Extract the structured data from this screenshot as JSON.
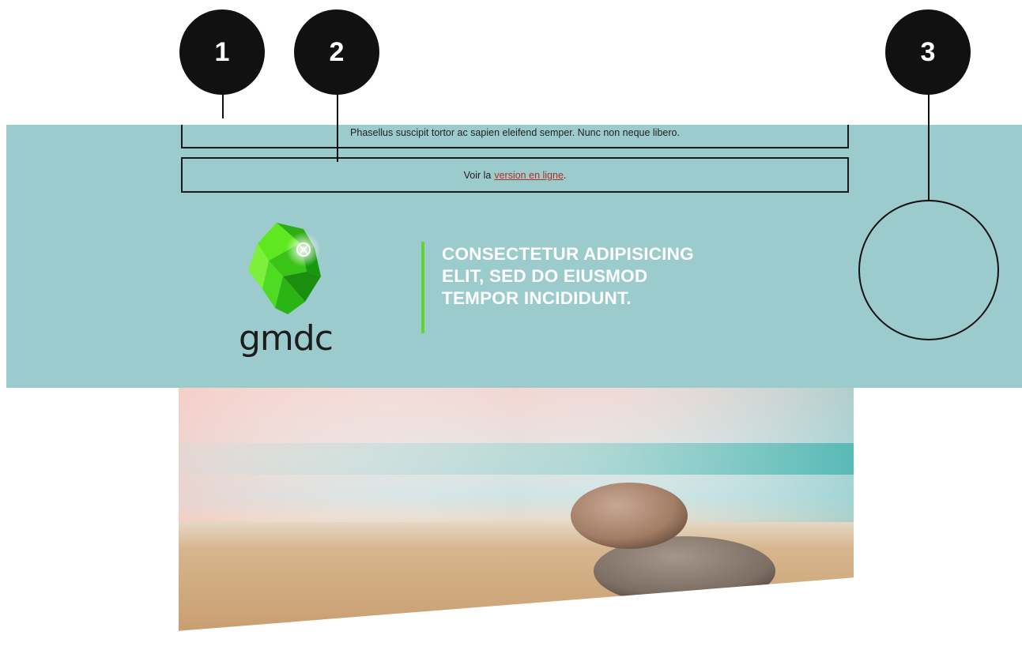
{
  "preheader": {
    "text": "Phasellus suscipit tortor ac sapien eleifend semper. Nunc non neque libero."
  },
  "web_version": {
    "prefix": "Voir la",
    "link_text": "version en ligne",
    "suffix": "."
  },
  "brand": {
    "logo_text": "gmdc",
    "accent_color": "#63d42f",
    "header_color": "#9ccbcd",
    "link_color": "#b0312a"
  },
  "header": {
    "tagline": "CONSECTETUR ADIPISICING ELIT, SED DO EIUSMOD TEMPOR INCIDIDUNT."
  },
  "callouts": [
    {
      "label": "1"
    },
    {
      "label": "2"
    },
    {
      "label": "3"
    }
  ],
  "hero": {
    "icon": "balanced-stones-image"
  }
}
